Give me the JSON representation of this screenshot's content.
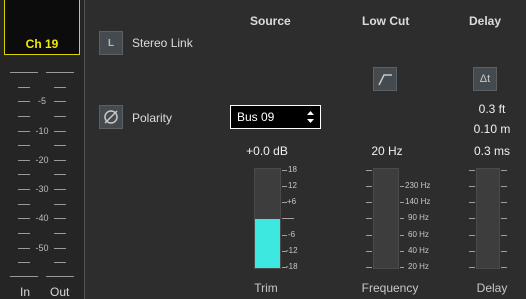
{
  "channel": {
    "label": "Ch 19"
  },
  "meter": {
    "scale": [
      "-5",
      "-10",
      "-20",
      "-30",
      "-40",
      "-50"
    ],
    "in_label": "In",
    "out_label": "Out"
  },
  "headers": {
    "source": "Source",
    "low_cut": "Low Cut",
    "delay": "Delay"
  },
  "stereo_link": {
    "button_label": "L",
    "label": "Stereo Link",
    "active": false
  },
  "polarity": {
    "label": "Polarity",
    "inverted": false
  },
  "source": {
    "selected": "Bus 09"
  },
  "trim": {
    "readout": "+0.0 dB",
    "scale_labels": [
      "18",
      "12",
      "+6",
      "-6",
      "-12",
      "-18"
    ],
    "level_fraction": 0.5,
    "footer": "Trim",
    "colors": {
      "fill": "#3de8e0"
    }
  },
  "low_cut": {
    "readout": "20 Hz",
    "scale_labels": [
      "230 Hz",
      "140 Hz",
      "90 Hz",
      "60 Hz",
      "40 Hz",
      "20 Hz"
    ],
    "footer": "Frequency",
    "button_icon": "high-pass-filter-icon"
  },
  "delay": {
    "readout_ft": "0.3 ft",
    "readout_m": "0.10 m",
    "readout_ms": "0.3 ms",
    "footer": "Delay",
    "button_icon": "delta-t-icon",
    "button_text": "Δt"
  },
  "colors": {
    "accent_yellow": "#f2ea00",
    "fill_cyan": "#3de8e0",
    "background": "#2d2d2d"
  }
}
